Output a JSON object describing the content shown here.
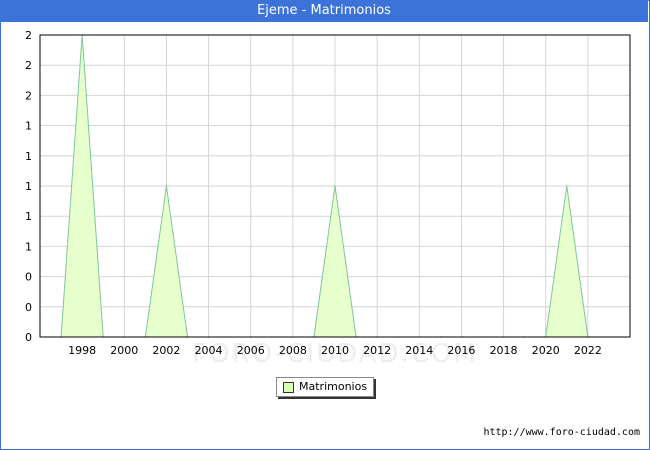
{
  "title": "Ejeme - Matrimonios",
  "credit": "http://www.foro-ciudad.com",
  "watermark": "FORO-CIUDAD.COM",
  "colors": {
    "title_bg": "#3b73d9",
    "fill": "#e6ffcc",
    "line": "#7fc69b",
    "grid": "#d4d4d4",
    "swatch": "#d9ffb3"
  },
  "chart_data": {
    "type": "area",
    "title": "Ejeme - Matrimonios",
    "xlabel": "",
    "ylabel": "",
    "xlim": [
      1996,
      2024
    ],
    "ylim": [
      0,
      2
    ],
    "x_ticks": [
      1998,
      2000,
      2002,
      2004,
      2006,
      2008,
      2010,
      2012,
      2014,
      2016,
      2018,
      2020,
      2022
    ],
    "y_tick_values": [
      0,
      0.2,
      0.4,
      0.6,
      0.8,
      1.0,
      1.2,
      1.4,
      1.6,
      1.8,
      2.0
    ],
    "y_tick_labels": [
      "0",
      "0",
      "0",
      "1",
      "1",
      "1",
      "1",
      "1",
      "2",
      "2",
      "2"
    ],
    "grid": true,
    "legend_position": "bottom-center",
    "series": [
      {
        "name": "Matrimonios",
        "x": [
          1997,
          1998,
          1999,
          2000,
          2001,
          2002,
          2003,
          2004,
          2005,
          2006,
          2007,
          2008,
          2009,
          2010,
          2011,
          2012,
          2013,
          2014,
          2015,
          2016,
          2017,
          2018,
          2019,
          2020,
          2021,
          2022
        ],
        "values": [
          0,
          2,
          0,
          0,
          0,
          1,
          0,
          0,
          0,
          0,
          0,
          0,
          0,
          1,
          0,
          0,
          0,
          0,
          0,
          0,
          0,
          0,
          0,
          0,
          1,
          0
        ]
      }
    ]
  }
}
